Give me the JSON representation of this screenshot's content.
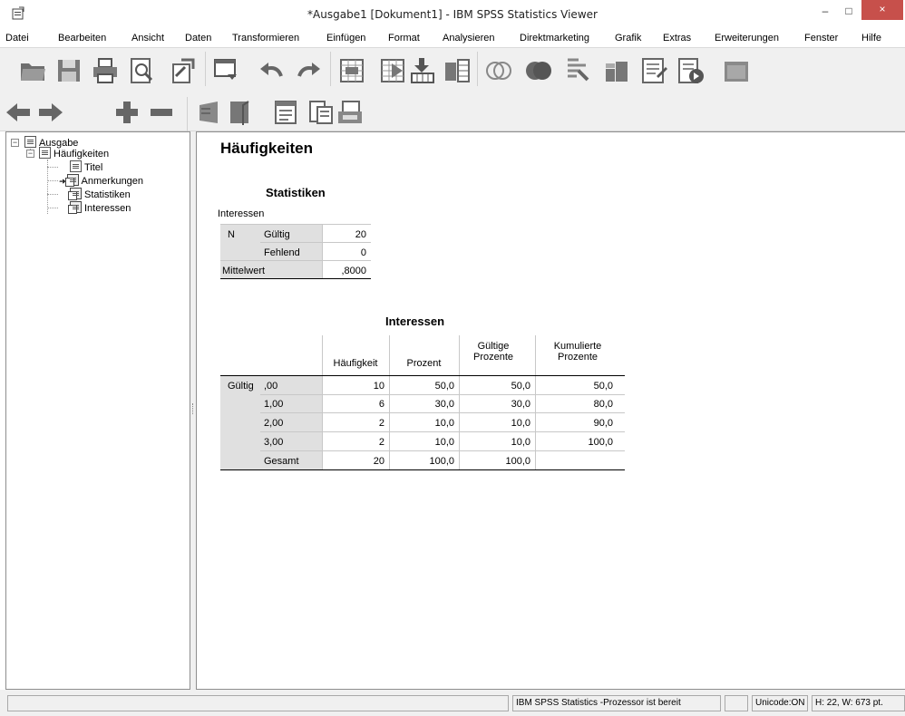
{
  "window": {
    "title": "*Ausgabe1 [Dokument1] - IBM SPSS Statistics Viewer",
    "minimize_glyph": "–",
    "maximize_glyph": "□",
    "close_glyph": "×"
  },
  "menu": [
    "Datei",
    "Bearbeiten",
    "Ansicht",
    "Daten",
    "Transformieren",
    "Einfügen",
    "Format",
    "Analysieren",
    "Direktmarketing",
    "Grafik",
    "Extras",
    "Erweiterungen",
    "Fenster",
    "Hilfe"
  ],
  "toolbar1": [
    "open-icon",
    "save-icon",
    "print-icon",
    "print-preview-icon",
    "export-icon",
    "recall-dialog-icon",
    "undo-icon",
    "redo-icon",
    "goto-data-icon",
    "goto-case-icon",
    "goto-variable-icon",
    "variables-icon",
    "use-sets-icon",
    "show-all-icon",
    "spell-check-icon",
    "value-labels-icon",
    "split-file-icon",
    "insert-output-icon",
    "run-script-icon",
    "designate-window-icon"
  ],
  "toolbar2": [
    "promote-icon",
    "demote-icon",
    "expand-icon",
    "collapse-icon",
    "show-icon",
    "hide-icon",
    "insert-heading-icon",
    "insert-title-icon",
    "insert-text-icon"
  ],
  "outline": {
    "root": "Ausgabe",
    "node": "Häufigkeiten",
    "children": [
      "Titel",
      "Anmerkungen",
      "Statistiken",
      "Interessen"
    ]
  },
  "content": {
    "heading": "Häufigkeiten",
    "stats_table": {
      "title": "Statistiken",
      "variable": "Interessen",
      "row_n": "N",
      "row_valid": "Gültig",
      "row_missing": "Fehlend",
      "row_mean": "Mittelwert",
      "val_valid": "20",
      "val_missing": "0",
      "val_mean": ",8000"
    },
    "freq_table": {
      "title": "Interessen",
      "headers": [
        "Häufigkeit",
        "Prozent",
        "Gültige Prozente",
        "Kumulierte Prozente"
      ],
      "row_group": "Gültig",
      "rows": [
        {
          "label": ",00",
          "freq": "10",
          "pct": "50,0",
          "valid_pct": "50,0",
          "cum_pct": "50,0"
        },
        {
          "label": "1,00",
          "freq": "6",
          "pct": "30,0",
          "valid_pct": "30,0",
          "cum_pct": "80,0"
        },
        {
          "label": "2,00",
          "freq": "2",
          "pct": "10,0",
          "valid_pct": "10,0",
          "cum_pct": "90,0"
        },
        {
          "label": "3,00",
          "freq": "2",
          "pct": "10,0",
          "valid_pct": "10,0",
          "cum_pct": "100,0"
        },
        {
          "label": "Gesamt",
          "freq": "20",
          "pct": "100,0",
          "valid_pct": "100,0",
          "cum_pct": ""
        }
      ]
    }
  },
  "status": {
    "processor": "IBM SPSS Statistics -Prozessor ist bereit",
    "unicode": "Unicode:ON",
    "dimensions": "H: 22, W: 673 pt."
  }
}
